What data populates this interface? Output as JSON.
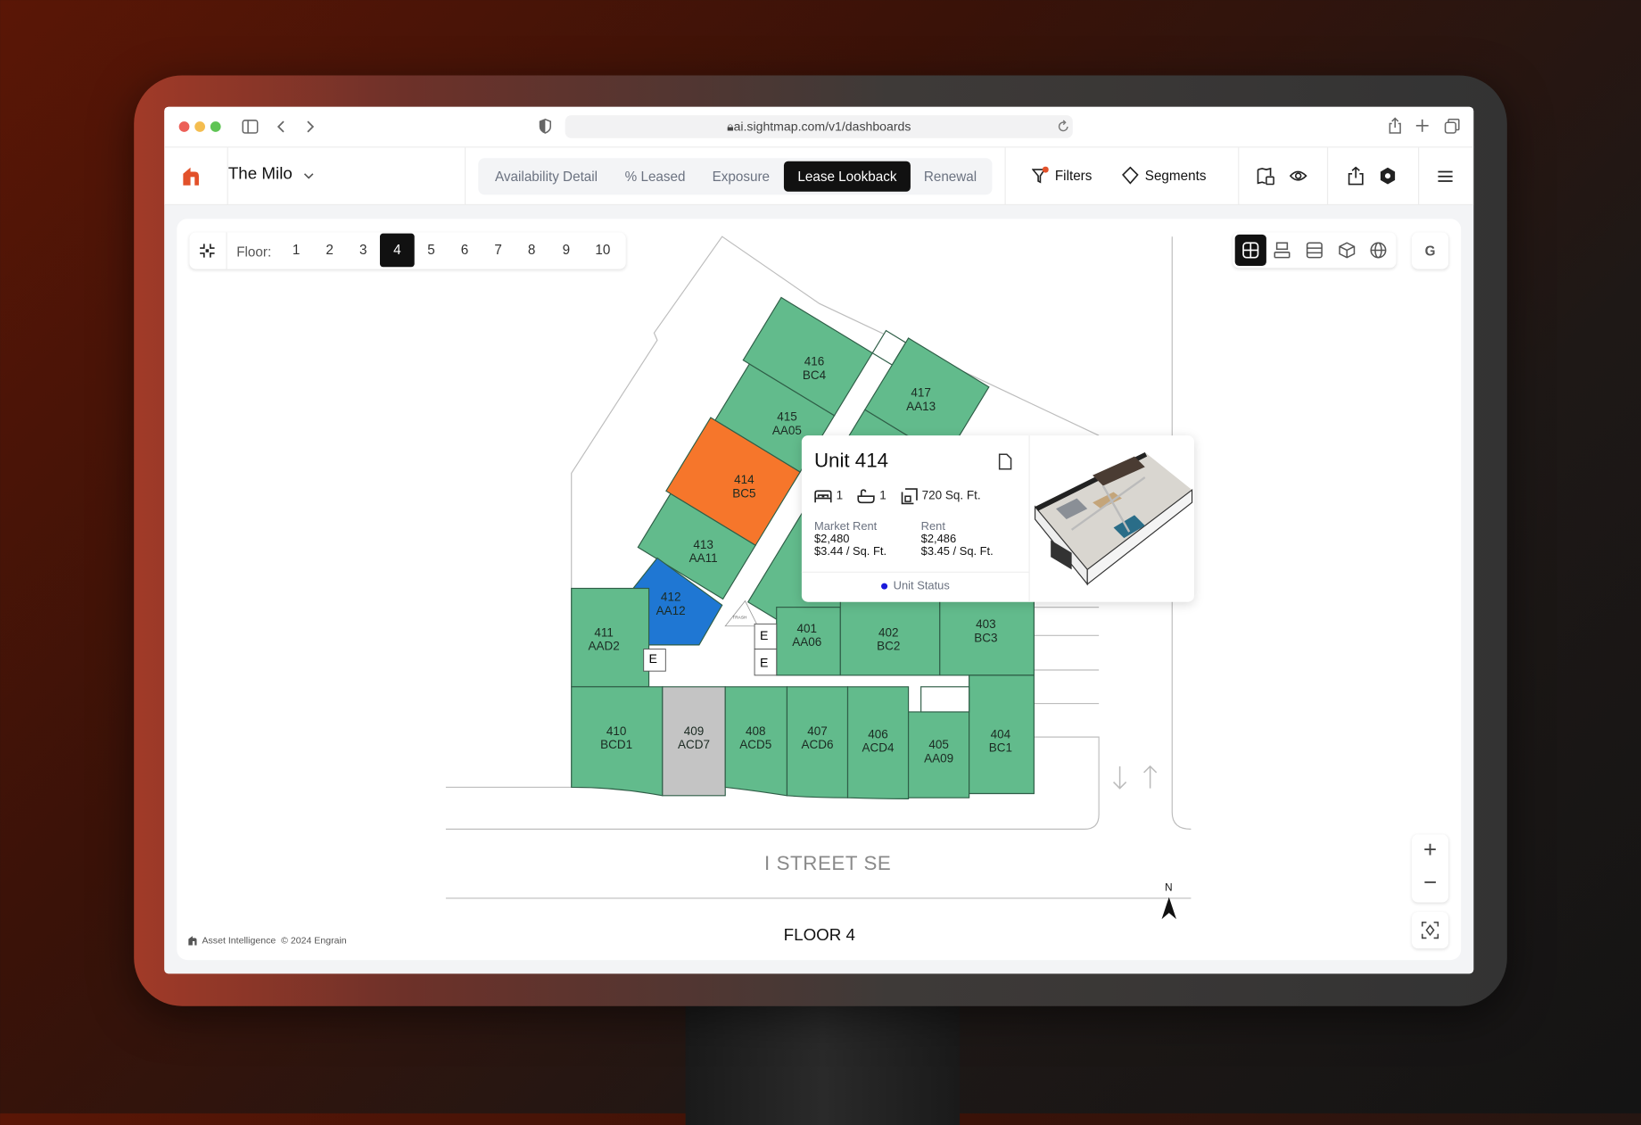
{
  "browser": {
    "url": "ai.sightmap.com/v1/dashboards",
    "traffic_lights": [
      "#ec5f57",
      "#f4bd4f",
      "#5fc454"
    ]
  },
  "header": {
    "property_name": "The Milo",
    "tabs": [
      {
        "label": "Availability Detail",
        "active": false
      },
      {
        "label": "% Leased",
        "active": false
      },
      {
        "label": "Exposure",
        "active": false
      },
      {
        "label": "Lease Lookback",
        "active": true
      },
      {
        "label": "Renewal",
        "active": false
      }
    ],
    "filters_label": "Filters",
    "segments_label": "Segments",
    "brand_color": "#e2512a"
  },
  "floor_selector": {
    "label": "Floor:",
    "floors": [
      "1",
      "2",
      "3",
      "4",
      "5",
      "6",
      "7",
      "8",
      "9",
      "10"
    ],
    "active": "4"
  },
  "view_modes": [
    "map-2d-icon",
    "stack-icon",
    "list-icon",
    "cube-3d-icon",
    "globe-icon"
  ],
  "google_label": "G",
  "map": {
    "street": "I STREET SE",
    "floor_title": "FLOOR 4",
    "north": "N",
    "elevator": "E",
    "trash": "TRASH",
    "colors": {
      "available": "#62bb8c",
      "selected": "#f6762b",
      "highlighted": "#1f77d3",
      "unavailable": "#c4c4c4"
    },
    "units": [
      {
        "number": "416",
        "plan": "BC4"
      },
      {
        "number": "417",
        "plan": "AA13"
      },
      {
        "number": "415",
        "plan": "AA05"
      },
      {
        "number": "414",
        "plan": "BC5"
      },
      {
        "number": "413",
        "plan": "AA11"
      },
      {
        "number": "412",
        "plan": "AA12"
      },
      {
        "number": "411",
        "plan": "AAD2"
      },
      {
        "number": "401",
        "plan": "AA06"
      },
      {
        "number": "402",
        "plan": "BC2"
      },
      {
        "number": "403",
        "plan": "BC3"
      },
      {
        "number": "410",
        "plan": "BCD1"
      },
      {
        "number": "409",
        "plan": "ACD7"
      },
      {
        "number": "408",
        "plan": "ACD5"
      },
      {
        "number": "407",
        "plan": "ACD6"
      },
      {
        "number": "406",
        "plan": "ACD4"
      },
      {
        "number": "405",
        "plan": "AA09"
      },
      {
        "number": "404",
        "plan": "BC1"
      }
    ]
  },
  "popup": {
    "title": "Unit 414",
    "beds": "1",
    "baths": "1",
    "area": "720 Sq. Ft.",
    "market_rent_label": "Market Rent",
    "market_rent": "$2,480",
    "market_rent_sqft": "$3.44 / Sq. Ft.",
    "rent_label": "Rent",
    "rent": "$2,486",
    "rent_sqft": "$3.45 / Sq. Ft.",
    "status_label": "Unit Status",
    "status_color": "#1a1adb"
  },
  "footer": {
    "brand": "Asset Intelligence",
    "copyright": "© 2024 Engrain"
  },
  "zoom": {
    "in": "+",
    "out": "−"
  }
}
